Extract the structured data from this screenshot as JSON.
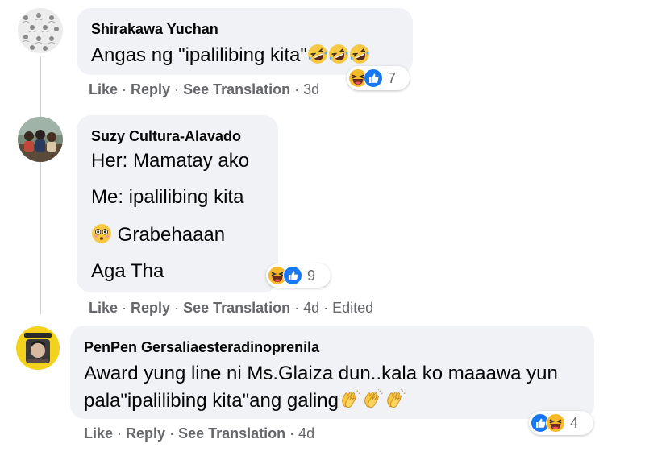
{
  "comments": [
    {
      "author": "Shirakawa Yuchan",
      "lines": [
        "Angas ng \"ipalilibing kita\""
      ],
      "actions": {
        "like": "Like",
        "reply": "Reply",
        "translate": "See Translation",
        "time": "3d"
      },
      "reaction_count": "7",
      "reaction_icons": [
        "laugh-icon",
        "like-icon"
      ]
    },
    {
      "author": "Suzy Cultura-Alavado",
      "lines": [
        "Her: Mamatay ako",
        "Me: ipalilibing kita",
        "Grabehaaan",
        "Aga Tha"
      ],
      "actions": {
        "like": "Like",
        "reply": "Reply",
        "translate": "See Translation",
        "time": "4d",
        "edited": "Edited"
      },
      "reaction_count": "9",
      "reaction_icons": [
        "laugh-icon",
        "like-icon"
      ]
    },
    {
      "author": "PenPen Gersaliaesteradinoprenila",
      "lines": [
        "Award yung line ni Ms.Glaiza dun..kala ko maaawa yun",
        "pala\"ipalilibing kita\"ang galing"
      ],
      "actions": {
        "like": "Like",
        "reply": "Reply",
        "translate": "See Translation",
        "time": "4d"
      },
      "reaction_count": "4",
      "reaction_icons": [
        "like-icon",
        "laugh-icon"
      ]
    }
  ],
  "colors": {
    "bubble": "#f0f2f5",
    "muted": "#65676b",
    "like_blue": "#1877f2",
    "emoji_yellow": "#f7c843"
  }
}
